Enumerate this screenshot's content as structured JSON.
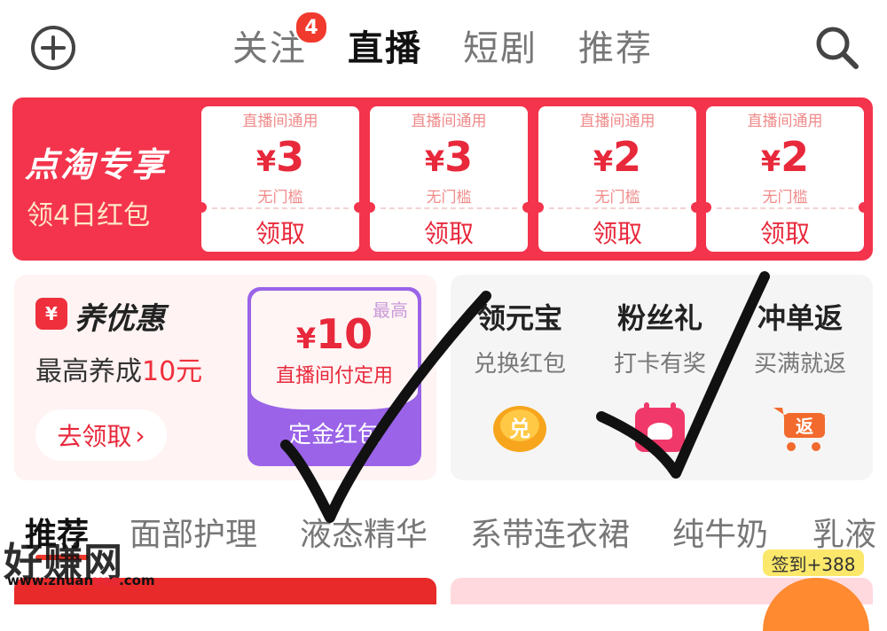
{
  "header": {
    "tabs": [
      {
        "label": "关注",
        "badge": "4"
      },
      {
        "label": "直播",
        "active": true
      },
      {
        "label": "短剧"
      },
      {
        "label": "推荐"
      }
    ],
    "add_icon": "plus-circle-icon",
    "search_icon": "search-icon"
  },
  "banner": {
    "title": "点淘专享",
    "subtitle": "领4日红包",
    "coupons": [
      {
        "tag": "直播间通用",
        "currency": "¥",
        "amount": "3",
        "condition": "无门槛",
        "action": "领取"
      },
      {
        "tag": "直播间通用",
        "currency": "¥",
        "amount": "3",
        "condition": "无门槛",
        "action": "领取"
      },
      {
        "tag": "直播间通用",
        "currency": "¥",
        "amount": "2",
        "condition": "无门槛",
        "action": "领取"
      },
      {
        "tag": "直播间通用",
        "currency": "¥",
        "amount": "2",
        "condition": "无门槛",
        "action": "领取"
      }
    ]
  },
  "promo_left": {
    "icon_char": "¥",
    "title": "养优惠",
    "subtitle_prefix": "最高养成",
    "subtitle_highlight": "10元",
    "button": "去领取",
    "button_arrow": "›",
    "deposit": {
      "tag": "最高",
      "currency": "¥",
      "amount": "10",
      "desc": "直播间付定用",
      "button": "定金红包"
    }
  },
  "promo_right": {
    "features": [
      {
        "title": "领元宝",
        "subtitle": "兑换红包",
        "icon": "gold-ingot-icon",
        "icon_text": "兑"
      },
      {
        "title": "粉丝礼",
        "subtitle": "打卡有奖",
        "icon": "calendar-gift-icon"
      },
      {
        "title": "冲单返",
        "subtitle": "买满就返",
        "icon": "shopping-cart-icon",
        "icon_text": "返"
      }
    ]
  },
  "categories": [
    "推荐",
    "面部护理",
    "液态精华",
    "系带连衣裙",
    "纯牛奶",
    "乳液"
  ],
  "checkin": {
    "label": "签到+388"
  },
  "watermark": {
    "text": "好赚网",
    "url_prefix": "www.zhuan",
    "url_highlight": "yes",
    "url_suffix": ".com"
  },
  "colors": {
    "banner_red": "#f3344c",
    "accent_red": "#e8283b",
    "deposit_purple": "#9a63e8",
    "checkin_yellow": "#fbe76a"
  }
}
